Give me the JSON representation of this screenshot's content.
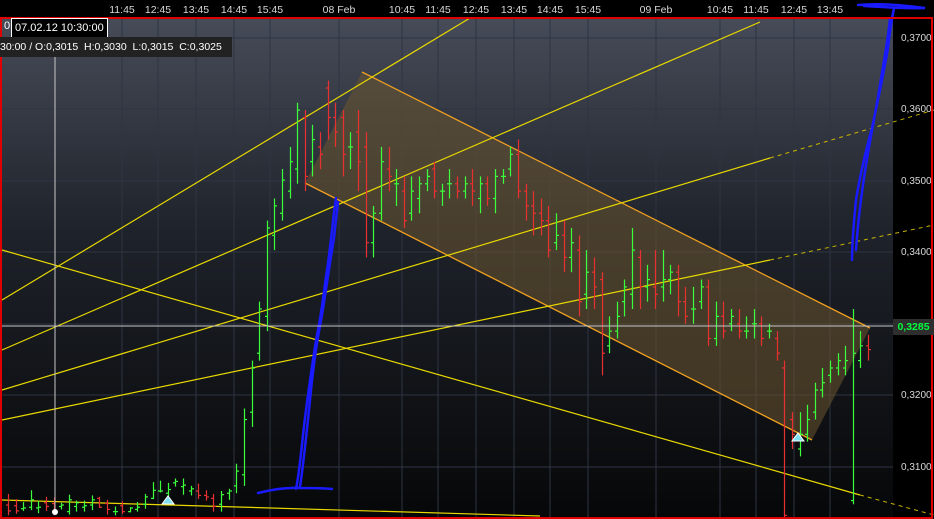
{
  "chart_data": {
    "type": "candlestick",
    "timeline_labels": [
      "11:45",
      "12:45",
      "13:45",
      "14:45",
      "15:45",
      "08 Feb",
      "10:45",
      "11:45",
      "12:45",
      "13:45",
      "14:45",
      "15:45",
      "09 Feb",
      "10:45",
      "11:45",
      "12:45",
      "13:45"
    ],
    "price_labels": [
      "0,3700",
      "0,3600",
      "0,3500",
      "0,3400",
      "0,3300",
      "0,3200",
      "0,3100"
    ],
    "last_price": "0,3285",
    "cursor_date": "07.02.12 10:30:00",
    "cursor_cut_char": "0",
    "ohlc_readout": "30:00 / O:0,3015  H:0,3030  L:0,3015  C:0,3025",
    "ylim": [
      0.3055,
      0.3735
    ],
    "candles": [
      [
        0.3074,
        0.3066,
        0.3089,
        0.306
      ],
      [
        0.3073,
        0.3066,
        0.3082,
        0.3062
      ],
      [
        0.3069,
        0.307,
        0.3078,
        0.3066
      ],
      [
        0.3071,
        0.3081,
        0.3094,
        0.3067
      ],
      [
        0.307,
        0.3071,
        0.308,
        0.3063
      ],
      [
        0.3077,
        0.3072,
        0.3085,
        0.3066
      ],
      [
        0.3076,
        0.3066,
        0.3084,
        0.306
      ],
      [
        0.3072,
        0.3074,
        0.3077,
        0.3068
      ],
      [
        0.3065,
        0.3081,
        0.3088,
        0.3061
      ],
      [
        0.3072,
        0.3077,
        0.308,
        0.3065
      ],
      [
        0.3071,
        0.3073,
        0.308,
        0.3065
      ],
      [
        0.3074,
        0.3081,
        0.3087,
        0.3067
      ],
      [
        0.3083,
        0.3071,
        0.3085,
        0.307
      ],
      [
        0.3076,
        0.3068,
        0.3081,
        0.3061
      ],
      [
        0.3065,
        0.3065,
        0.3072,
        0.306
      ],
      [
        0.3073,
        0.3065,
        0.3079,
        0.3062
      ],
      [
        0.3065,
        0.307,
        0.3071,
        0.3064
      ],
      [
        0.3068,
        0.3071,
        0.3078,
        0.3065
      ],
      [
        0.3075,
        0.3085,
        0.3089,
        0.3069
      ],
      [
        0.3083,
        0.3094,
        0.3105,
        0.3082
      ],
      [
        0.3093,
        0.3093,
        0.3107,
        0.3091
      ],
      [
        0.309,
        0.3095,
        0.3104,
        0.3086
      ],
      [
        0.3104,
        0.3106,
        0.311,
        0.3099
      ],
      [
        0.3099,
        0.3101,
        0.311,
        0.3088
      ],
      [
        0.3093,
        0.3096,
        0.31,
        0.3087
      ],
      [
        0.3093,
        0.3087,
        0.3103,
        0.3082
      ],
      [
        0.3087,
        0.3085,
        0.3094,
        0.308
      ],
      [
        0.3083,
        0.3072,
        0.3089,
        0.3065
      ],
      [
        0.3075,
        0.3088,
        0.3093,
        0.3065
      ],
      [
        0.309,
        0.3093,
        0.3096,
        0.3081
      ],
      [
        0.31,
        0.312,
        0.313,
        0.309
      ],
      [
        0.3115,
        0.319,
        0.3205,
        0.31
      ],
      [
        0.32,
        0.326,
        0.327,
        0.318
      ],
      [
        0.328,
        0.334,
        0.335,
        0.327
      ],
      [
        0.333,
        0.345,
        0.346,
        0.331
      ],
      [
        0.344,
        0.348,
        0.349,
        0.342
      ],
      [
        0.347,
        0.3515,
        0.353,
        0.346
      ],
      [
        0.35,
        0.354,
        0.356,
        0.349
      ],
      [
        0.353,
        0.361,
        0.362,
        0.351
      ],
      [
        0.36,
        0.352,
        0.361,
        0.35
      ],
      [
        0.354,
        0.357,
        0.359,
        0.352
      ],
      [
        0.356,
        0.355,
        0.358,
        0.353
      ],
      [
        0.364,
        0.36,
        0.365,
        0.357
      ],
      [
        0.36,
        0.358,
        0.362,
        0.356
      ],
      [
        0.36,
        0.355,
        0.361,
        0.352
      ],
      [
        0.356,
        0.356,
        0.358,
        0.353
      ],
      [
        0.358,
        0.354,
        0.361,
        0.35
      ],
      [
        0.356,
        0.343,
        0.358,
        0.341
      ],
      [
        0.343,
        0.347,
        0.348,
        0.341
      ],
      [
        0.347,
        0.354,
        0.356,
        0.346
      ],
      [
        0.353,
        0.352,
        0.356,
        0.35
      ],
      [
        0.351,
        0.351,
        0.353,
        0.348
      ],
      [
        0.35,
        0.346,
        0.352,
        0.345
      ],
      [
        0.347,
        0.35,
        0.352,
        0.346
      ],
      [
        0.349,
        0.351,
        0.352,
        0.347
      ],
      [
        0.351,
        0.352,
        0.353,
        0.35
      ],
      [
        0.353,
        0.35,
        0.354,
        0.349
      ],
      [
        0.35,
        0.35,
        0.351,
        0.348
      ],
      [
        0.351,
        0.351,
        0.353,
        0.349
      ],
      [
        0.351,
        0.35,
        0.352,
        0.349
      ],
      [
        0.35,
        0.351,
        0.352,
        0.349
      ],
      [
        0.351,
        0.35,
        0.353,
        0.348
      ],
      [
        0.349,
        0.351,
        0.352,
        0.347
      ],
      [
        0.351,
        0.349,
        0.352,
        0.348
      ],
      [
        0.349,
        0.352,
        0.353,
        0.347
      ],
      [
        0.352,
        0.352,
        0.353,
        0.351
      ],
      [
        0.353,
        0.355,
        0.356,
        0.352
      ],
      [
        0.355,
        0.35,
        0.357,
        0.349
      ],
      [
        0.35,
        0.348,
        0.351,
        0.346
      ],
      [
        0.348,
        0.347,
        0.35,
        0.344
      ],
      [
        0.347,
        0.346,
        0.349,
        0.344
      ],
      [
        0.346,
        0.342,
        0.348,
        0.341
      ],
      [
        0.343,
        0.344,
        0.347,
        0.342
      ],
      [
        0.344,
        0.341,
        0.346,
        0.339
      ],
      [
        0.341,
        0.343,
        0.345,
        0.339
      ],
      [
        0.342,
        0.335,
        0.344,
        0.333
      ],
      [
        0.336,
        0.339,
        0.342,
        0.334
      ],
      [
        0.339,
        0.337,
        0.341,
        0.334
      ],
      [
        0.338,
        0.328,
        0.339,
        0.325
      ],
      [
        0.329,
        0.331,
        0.333,
        0.328
      ],
      [
        0.331,
        0.333,
        0.335,
        0.33
      ],
      [
        0.335,
        0.337,
        0.338,
        0.333
      ],
      [
        0.336,
        0.342,
        0.345,
        0.334
      ],
      [
        0.341,
        0.337,
        0.342,
        0.334
      ],
      [
        0.337,
        0.338,
        0.34,
        0.335
      ],
      [
        0.337,
        0.336,
        0.342,
        0.334
      ],
      [
        0.337,
        0.338,
        0.342,
        0.335
      ],
      [
        0.338,
        0.339,
        0.34,
        0.336
      ],
      [
        0.339,
        0.335,
        0.34,
        0.333
      ],
      [
        0.335,
        0.333,
        0.337,
        0.332
      ],
      [
        0.334,
        0.334,
        0.337,
        0.332
      ],
      [
        0.335,
        0.337,
        0.338,
        0.334
      ],
      [
        0.337,
        0.33,
        0.338,
        0.329
      ],
      [
        0.33,
        0.333,
        0.335,
        0.329
      ],
      [
        0.333,
        0.331,
        0.335,
        0.33
      ],
      [
        0.332,
        0.333,
        0.334,
        0.331
      ],
      [
        0.332,
        0.331,
        0.334,
        0.33
      ],
      [
        0.331,
        0.331,
        0.333,
        0.33
      ],
      [
        0.332,
        0.332,
        0.334,
        0.33
      ],
      [
        0.332,
        0.33,
        0.333,
        0.329
      ],
      [
        0.331,
        0.331,
        0.332,
        0.33
      ],
      [
        0.33,
        0.328,
        0.331,
        0.327
      ],
      [
        0.326,
        0.306,
        0.327,
        0.305
      ],
      [
        0.319,
        0.317,
        0.32,
        0.315
      ],
      [
        0.315,
        0.317,
        0.32,
        0.314
      ],
      [
        0.317,
        0.319,
        0.321,
        0.316
      ],
      [
        0.32,
        0.323,
        0.324,
        0.319
      ],
      [
        0.323,
        0.324,
        0.326,
        0.322
      ],
      [
        0.325,
        0.326,
        0.327,
        0.324
      ],
      [
        0.326,
        0.327,
        0.328,
        0.325
      ],
      [
        0.326,
        0.327,
        0.329,
        0.325
      ],
      [
        0.308,
        0.328,
        0.334,
        0.3075
      ],
      [
        0.327,
        0.329,
        0.331,
        0.326
      ],
      [
        0.329,
        0.3285,
        0.3305,
        0.327
      ]
    ],
    "trendlines": [
      {
        "color": "#e8d800",
        "from": [
          2,
          300
        ],
        "to": [
          470,
          18
        ]
      },
      {
        "color": "#e8d800",
        "from": [
          2,
          350
        ],
        "to": [
          760,
          22
        ]
      },
      {
        "color": "#e8d800",
        "from": [
          2,
          390
        ],
        "to": [
          770,
          158
        ]
      },
      {
        "color": "#e8d800",
        "from": [
          2,
          420
        ],
        "to": [
          770,
          260
        ]
      },
      {
        "color": "#e8d800",
        "from": [
          2,
          250
        ],
        "to": [
          860,
          495
        ]
      },
      {
        "color": "#e8d800",
        "from": [
          2,
          500
        ],
        "to": [
          540,
          516
        ]
      }
    ],
    "trendline_extensions": [
      {
        "color": "#c8b400",
        "from": [
          770,
          158
        ],
        "to": [
          934,
          110
        ]
      },
      {
        "color": "#c8b400",
        "from": [
          770,
          260
        ],
        "to": [
          934,
          225
        ]
      },
      {
        "color": "#c8b400",
        "from": [
          860,
          495
        ],
        "to": [
          934,
          515
        ]
      }
    ],
    "channel": {
      "upper": [
        [
          362,
          72
        ],
        [
          870,
          328
        ]
      ],
      "lower": [
        [
          305,
          183
        ],
        [
          812,
          440
        ]
      ],
      "fill": "#6b5530",
      "line": "#f0a020"
    },
    "markers": [
      {
        "x": 168,
        "y": 500
      },
      {
        "x": 798,
        "y": 437
      }
    ],
    "drawing_color": "#1a1aff",
    "colors": {
      "up": "#3cff3c",
      "down": "#e83030",
      "frame": "#e00000",
      "grid": "#2e3442"
    }
  }
}
